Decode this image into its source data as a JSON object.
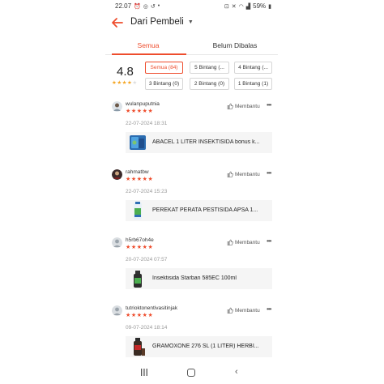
{
  "status_bar": {
    "time": "22.07",
    "battery": "59%"
  },
  "header": {
    "title": "Dari Pembeli"
  },
  "tabs": [
    {
      "label": "Semua"
    },
    {
      "label": "Belum Dibalas"
    }
  ],
  "summary": {
    "score": "4.8",
    "filters": [
      {
        "label": "Semua (84)"
      },
      {
        "label": "5 Bintang (..."
      },
      {
        "label": "4 Bintang (..."
      },
      {
        "label": "3 Bintang (0)"
      },
      {
        "label": "2 Bintang (0)"
      },
      {
        "label": "1 Bintang (1)"
      }
    ]
  },
  "help_label": "Membantu",
  "reviews": [
    {
      "username": "wulanpuputnia",
      "stars": "★★★★★",
      "date": "22-07-2024 18:31",
      "product": "ABACEL 1 LITER INSEKTISIDA bonus k..."
    },
    {
      "username": "rahmatbw",
      "stars": "★★★★★",
      "date": "22-07-2024 15:23",
      "product": "PEREKAT PERATA PESTISIDA APSA 1..."
    },
    {
      "username": "h5rb67oh4e",
      "stars": "★★★★★",
      "date": "20-07-2024 07:57",
      "product": "Insektisida Starban 585EC 100ml"
    },
    {
      "username": "tutrioktonentivasitinjak",
      "stars": "★★★★★",
      "date": "09-07-2024 18:14",
      "product": "GRAMOXONE 276 SL (1 LITER) HERBI..."
    }
  ],
  "colors": {
    "accent": "#ee4d2d",
    "star": "#ee4d2d"
  }
}
